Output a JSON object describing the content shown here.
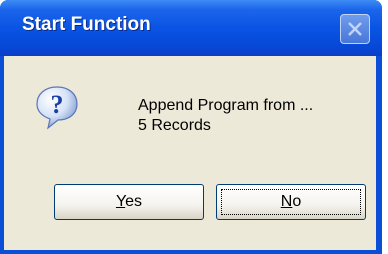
{
  "window": {
    "title": "Start Function",
    "close_icon": "close-icon"
  },
  "message": {
    "icon": "question-icon",
    "line1": "Append Program from ...",
    "line2": "5 Records"
  },
  "buttons": {
    "yes": {
      "mnemonic": "Y",
      "rest": "es"
    },
    "no": {
      "mnemonic": "N",
      "rest": "o"
    }
  },
  "colors": {
    "titlebar": "#0a54e4",
    "client": "#ece9d8",
    "button_border": "#003c74"
  }
}
